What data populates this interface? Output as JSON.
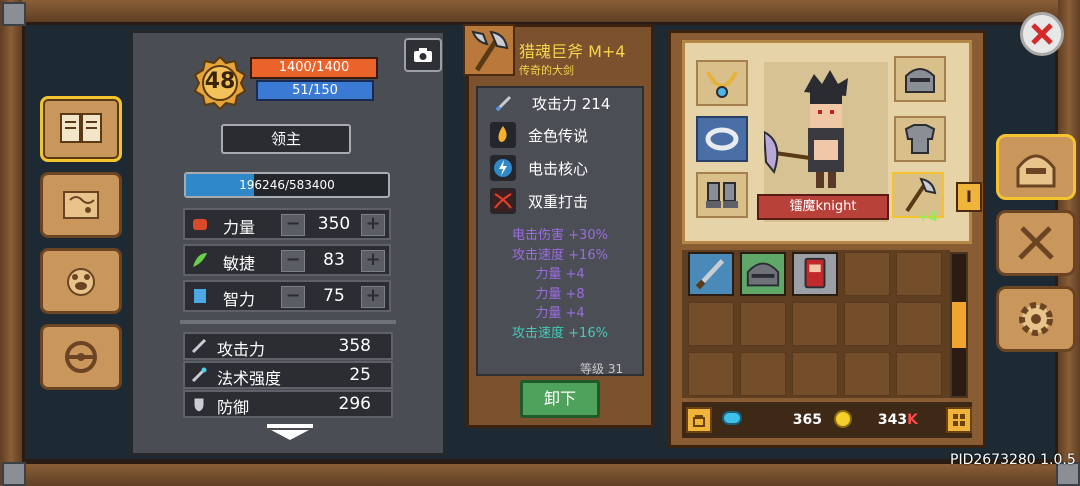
{
  "character": {
    "level": "48",
    "hp": "1400/1400",
    "mp": "51/150",
    "class_label": "领主",
    "xp_text": "196246/583400",
    "xp_fraction": 0.336,
    "stats": [
      {
        "label": "力量",
        "value": "350",
        "icon": "strength-fist-icon"
      },
      {
        "label": "敏捷",
        "value": "83",
        "icon": "agility-leaf-icon"
      },
      {
        "label": "智力",
        "value": "75",
        "icon": "intelligence-book-icon"
      }
    ],
    "attributes": [
      {
        "label": "攻击力",
        "value": "358",
        "icon": "sword-icon"
      },
      {
        "label": "法术强度",
        "value": "25",
        "icon": "wand-icon"
      },
      {
        "label": "防御",
        "value": "296",
        "icon": "shield-icon"
      }
    ]
  },
  "item": {
    "name": "猎魂巨斧 M+4",
    "subtitle": "传奇的大剑",
    "attack_line": "攻击力 214",
    "traits": [
      {
        "label": "金色传说",
        "icon": "flame-icon"
      },
      {
        "label": "电击核心",
        "icon": "lightning-icon"
      },
      {
        "label": "双重打击",
        "icon": "slash-icon"
      }
    ],
    "bonuses": [
      {
        "text": "电击伤害 +30%",
        "color": "#9b6ce0"
      },
      {
        "text": "攻击速度 +16%",
        "color": "#9b6ce0"
      },
      {
        "text": "力量 +4",
        "color": "#9b6ce0"
      },
      {
        "text": "力量 +8",
        "color": "#9b6ce0"
      },
      {
        "text": "力量 +4",
        "color": "#9b6ce0"
      },
      {
        "text": "攻击速度 +16%",
        "color": "#46c8b8"
      }
    ],
    "level_req": "等级 31",
    "unequip_label": "卸下"
  },
  "equipment": {
    "character_name": "镭魔knight",
    "weapon_bonus": "+4",
    "gems": "365",
    "coins": "343",
    "coins_suffix": "K"
  },
  "footer": {
    "pid": "PID2673280 1.0.5"
  },
  "colors": {
    "accent_gold": "#f4c430",
    "hp": "#e9632a",
    "mp": "#3a7ad4",
    "xp": "#2f88c8"
  }
}
